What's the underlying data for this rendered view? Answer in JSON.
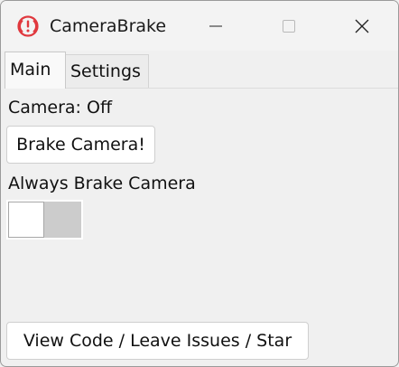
{
  "window": {
    "title": "CameraBrake",
    "app_icon": "warning-circle-icon"
  },
  "tabs": [
    {
      "label": "Main",
      "selected": true
    },
    {
      "label": "Settings",
      "selected": false
    }
  ],
  "main": {
    "camera_status": "Camera: Off",
    "brake_button_label": "Brake Camera!",
    "always_brake_label": "Always Brake Camera",
    "always_brake_enabled": false,
    "view_code_button_label": "View Code / Leave Issues / Star"
  },
  "colors": {
    "app_icon_red": "#e0383e",
    "background": "#f0f0f0",
    "toggle_track": "#cccccc"
  }
}
